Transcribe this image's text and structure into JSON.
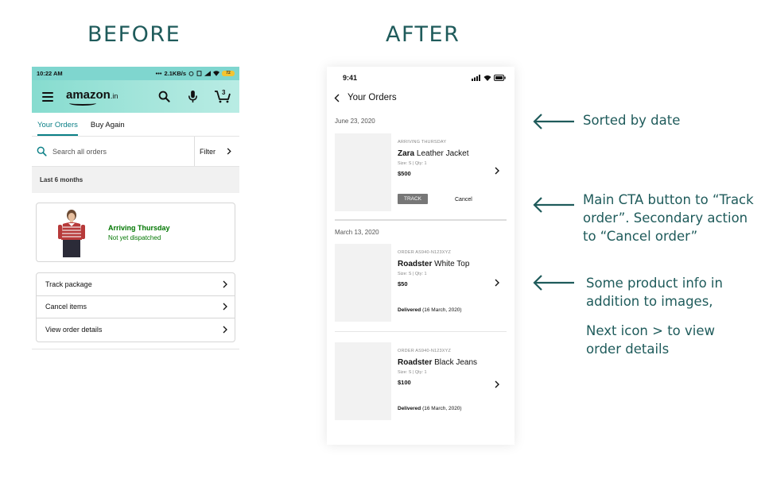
{
  "headings": {
    "before": "BEFORE",
    "after": "AFTER"
  },
  "colors": {
    "heading": "#1f5b5b",
    "amazon_teal": "#86dccf",
    "tab_active": "#0a7f86",
    "arriving_green": "#007600"
  },
  "before": {
    "status": {
      "time": "10:22 AM",
      "speed": "2.1KB/s",
      "battery": "72"
    },
    "header": {
      "logo": "amazon",
      "logo_tld": ".in",
      "cart_count": "3",
      "icons": [
        "menu-icon",
        "search-icon",
        "microphone-icon",
        "cart-icon"
      ]
    },
    "tabs": [
      {
        "label": "Your Orders",
        "active": true
      },
      {
        "label": "Buy Again",
        "active": false
      }
    ],
    "search": {
      "placeholder": "Search all orders",
      "filter_label": "Filter"
    },
    "period_label": "Last 6 months",
    "order_card": {
      "arrival": "Arriving Thursday",
      "status": "Not yet dispatched"
    },
    "actions": [
      {
        "label": "Track package"
      },
      {
        "label": "Cancel items"
      },
      {
        "label": "View order details"
      }
    ]
  },
  "after": {
    "status": {
      "time": "9:41"
    },
    "title": "Your Orders",
    "orders": [
      {
        "date": "June 23, 2020",
        "small_label": "ARRIVING THURSDAY",
        "brand": "Zara",
        "product": "Leather Jacket",
        "meta": "Size: S | Qty: 1",
        "price": "$500",
        "track_label": "TRACK",
        "cancel_label": "Cancel"
      },
      {
        "date": "March 13, 2020",
        "small_label": "ORDER AS940-N123XYZ",
        "brand": "Roadster",
        "product": "White Top",
        "meta": "Size: S | Qty: 1",
        "price": "$50",
        "delivered_label": "Delivered",
        "delivered_date": "(16 March, 2020)"
      },
      {
        "small_label": "ORDER AS940-N123XYZ",
        "brand": "Roadster",
        "product": "Black Jeans",
        "meta": "Size: S | Qty: 1",
        "price": "$100",
        "delivered_label": "Delivered",
        "delivered_date": "(16 March, 2020)"
      }
    ]
  },
  "annotations": {
    "sorted": "Sorted by date",
    "cta_line1": "Main CTA button to “Track",
    "cta_line2": "order”. Secondary action",
    "cta_line3": "to “Cancel order”",
    "info_line1": "Some product info in",
    "info_line2": "addition to images,",
    "next_line1": "Next icon > to view",
    "next_line2": "order details"
  }
}
